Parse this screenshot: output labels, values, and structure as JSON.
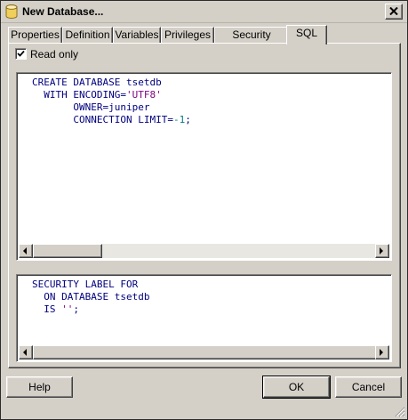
{
  "window": {
    "title": "New Database..."
  },
  "tabs": [
    {
      "label": "Properties"
    },
    {
      "label": "Definition"
    },
    {
      "label": "Variables"
    },
    {
      "label": "Privileges"
    },
    {
      "label": "Security Labels"
    },
    {
      "label": "SQL"
    }
  ],
  "active_tab": "SQL",
  "read_only": {
    "label": "Read only",
    "checked": true
  },
  "sql_editor": {
    "lines": [
      "CREATE DATABASE tsetdb",
      "  WITH ENCODING='UTF8'",
      "       OWNER=juniper",
      "       CONNECTION LIMIT=-1;"
    ]
  },
  "labels_editor": {
    "lines": [
      "SECURITY LABEL FOR",
      "  ON DATABASE tsetdb",
      "  IS '';"
    ]
  },
  "buttons": {
    "help": "Help",
    "ok": "OK",
    "cancel": "Cancel"
  },
  "icons": {
    "title_icon": "database-icon",
    "close": "close-icon",
    "scroll_left": "scroll-left-arrow-icon",
    "scroll_right": "scroll-right-arrow-icon",
    "checkmark": "checkmark-icon",
    "grip": "resize-grip-icon"
  },
  "colors": {
    "keyword": "#00007f",
    "string": "#7f007f",
    "number": "#007f7f",
    "face": "#d4d0c8"
  }
}
